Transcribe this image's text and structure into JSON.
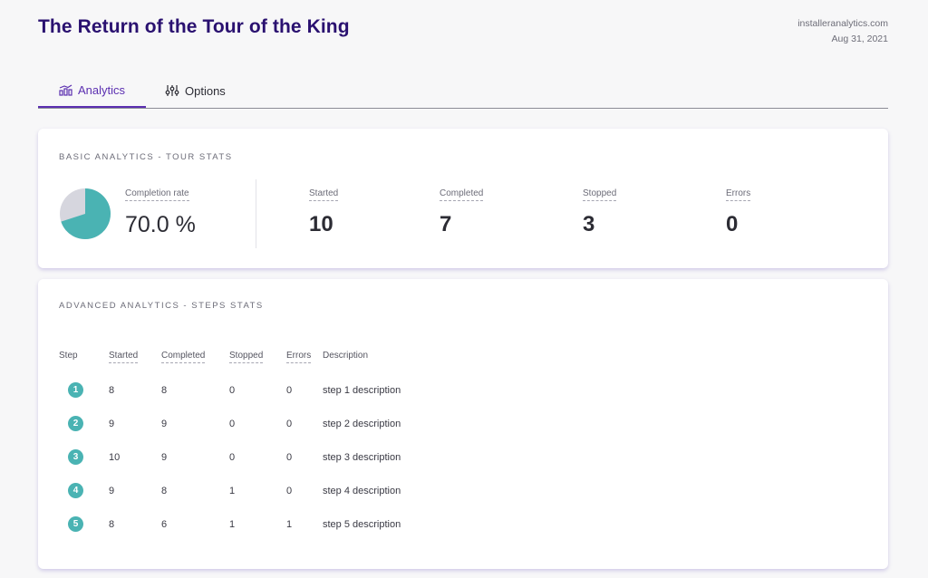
{
  "header": {
    "title": "The Return of the Tour of the King",
    "site": "installeranalytics.com",
    "date": "Aug 31, 2021"
  },
  "tabs": [
    {
      "label": "Analytics",
      "icon": "analytics-chart-icon",
      "active": true
    },
    {
      "label": "Options",
      "icon": "sliders-icon",
      "active": false
    }
  ],
  "basic": {
    "title": "BASIC ANALYTICS - TOUR STATS",
    "completion_label": "Completion rate",
    "completion_value": "70.0 %",
    "completion_fraction": 0.7,
    "stats": [
      {
        "label": "Started",
        "value": "10"
      },
      {
        "label": "Completed",
        "value": "7"
      },
      {
        "label": "Stopped",
        "value": "3"
      },
      {
        "label": "Errors",
        "value": "0"
      }
    ]
  },
  "advanced": {
    "title": "ADVANCED ANALYTICS - STEPS STATS",
    "columns": [
      "Step",
      "Started",
      "Completed",
      "Stopped",
      "Errors",
      "Description"
    ],
    "rows": [
      {
        "step": "1",
        "started": "8",
        "completed": "8",
        "stopped": "0",
        "errors": "0",
        "description": "step 1 description"
      },
      {
        "step": "2",
        "started": "9",
        "completed": "9",
        "stopped": "0",
        "errors": "0",
        "description": "step 2 description"
      },
      {
        "step": "3",
        "started": "10",
        "completed": "9",
        "stopped": "0",
        "errors": "0",
        "description": "step 3 description"
      },
      {
        "step": "4",
        "started": "9",
        "completed": "8",
        "stopped": "1",
        "errors": "0",
        "description": "step 4 description"
      },
      {
        "step": "5",
        "started": "8",
        "completed": "6",
        "stopped": "1",
        "errors": "1",
        "description": "step 5 description"
      }
    ]
  },
  "colors": {
    "accent": "#5b2fb0",
    "title": "#2a1170",
    "teal": "#4ab3b3",
    "pie_rest": "#d6d6de"
  }
}
